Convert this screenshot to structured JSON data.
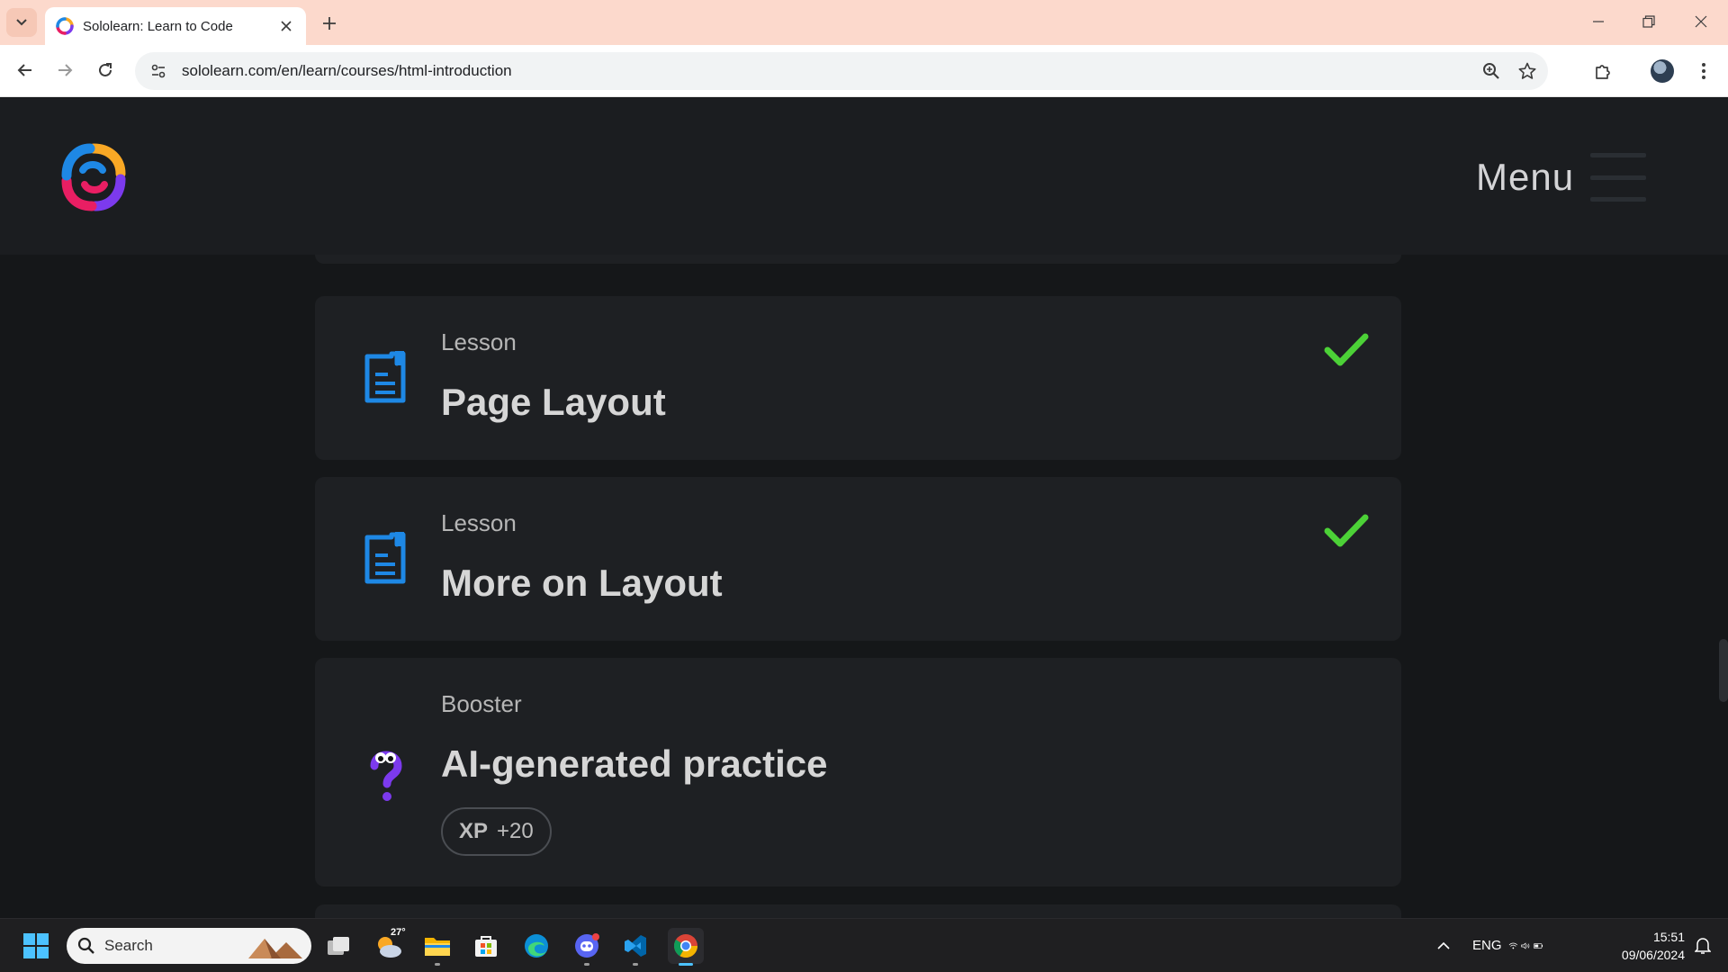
{
  "browser": {
    "tab_title": "Sololearn: Learn to Code",
    "url": "sololearn.com/en/learn/courses/html-introduction"
  },
  "header": {
    "menu_label": "Menu"
  },
  "cards": [
    {
      "kicker": "Lesson",
      "title": "Page Layout",
      "completed": true,
      "icon": "lesson-icon"
    },
    {
      "kicker": "Lesson",
      "title": "More on Layout",
      "completed": true,
      "icon": "lesson-icon"
    },
    {
      "kicker": "Booster",
      "title": "AI-generated practice",
      "icon": "booster-question-icon",
      "xp_label": "XP",
      "xp_value": "+20"
    }
  ],
  "taskbar": {
    "search_placeholder": "Search",
    "weather_temp": "27°",
    "language": "ENG",
    "time": "15:51",
    "date": "09/06/2024"
  },
  "colors": {
    "accent_blue": "#1e88e5",
    "check_green": "#4cd137",
    "booster_purple": "#7c3aed",
    "page_bg": "#151719",
    "card_bg": "#1e2023"
  }
}
